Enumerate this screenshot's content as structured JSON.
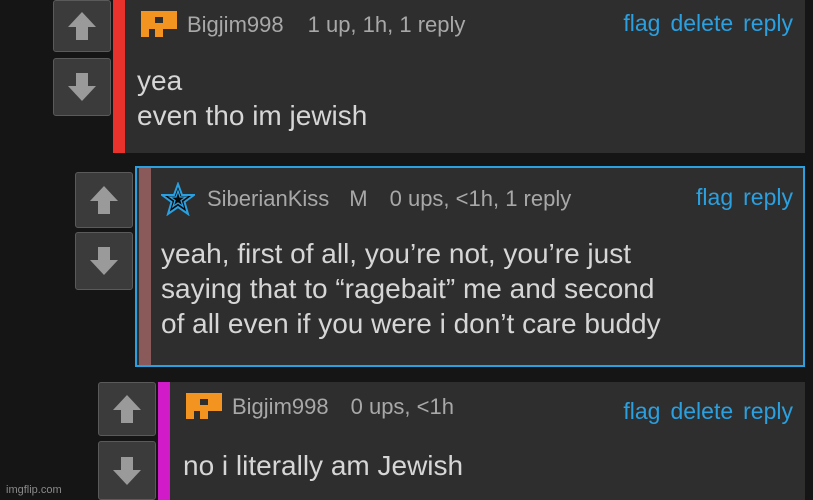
{
  "comments": [
    {
      "username": "Bigjim998",
      "meta": "1 up, 1h, 1 reply",
      "actions": [
        "flag",
        "delete",
        "reply"
      ],
      "lines": [
        "yea",
        "even tho im jewish"
      ],
      "bar_color": "#e8322b",
      "avatar": "imgflip-pixel-avatar-icon"
    },
    {
      "username": "SiberianKiss",
      "badge": "M",
      "meta": "0 ups, <1h, 1 reply",
      "actions": [
        "flag",
        "reply"
      ],
      "lines": [
        "yeah, first of all, you’re not, you’re just",
        "saying that to “ragebait” me and second",
        "of all even if you were i don’t care buddy"
      ],
      "bar_color": "#8a5a5a",
      "highlight_border": "#2aa0e0",
      "avatar": "blue-star-icon"
    },
    {
      "username": "Bigjim998",
      "meta": "0 ups, <1h",
      "actions": [
        "flag",
        "delete",
        "reply"
      ],
      "lines": [
        "no i literally am Jewish"
      ],
      "bar_color": "#d11bc8",
      "avatar": "imgflip-pixel-avatar-icon"
    }
  ],
  "watermark": "imgflip.com",
  "colors": {
    "link": "#2aa0e0",
    "text": "#d6d6d6",
    "meta": "#a8a8a8",
    "background": "#151515",
    "card": "#2e2e2e"
  }
}
